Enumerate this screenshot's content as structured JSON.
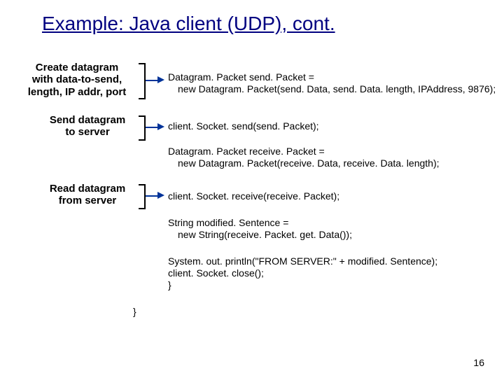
{
  "title": "Example: Java client (UDP), cont.",
  "ann": {
    "create": {
      "l1": "Create datagram",
      "l2": "with data-to-send,",
      "l3": "length, IP addr, port"
    },
    "send": {
      "l1": "Send datagram",
      "l2": "to server"
    },
    "read": {
      "l1": "Read datagram",
      "l2": "from server"
    }
  },
  "code": {
    "c1": "Datagram. Packet send. Packet =",
    "c1b": "new Datagram. Packet(send. Data, send. Data. length, IPAddress, 9876);",
    "c2": "client. Socket. send(send. Packet);",
    "c3": "Datagram. Packet receive. Packet =",
    "c3b": "new Datagram. Packet(receive. Data, receive. Data. length);",
    "c4": "client. Socket. receive(receive. Packet);",
    "c5": "String modified. Sentence =",
    "c5b": "new String(receive. Packet. get. Data());",
    "c6": "System. out. println(\"FROM SERVER:\" + modified. Sentence);",
    "c7": "client. Socket. close();",
    "c8": "}",
    "c9": "}"
  },
  "pagenum": "16"
}
